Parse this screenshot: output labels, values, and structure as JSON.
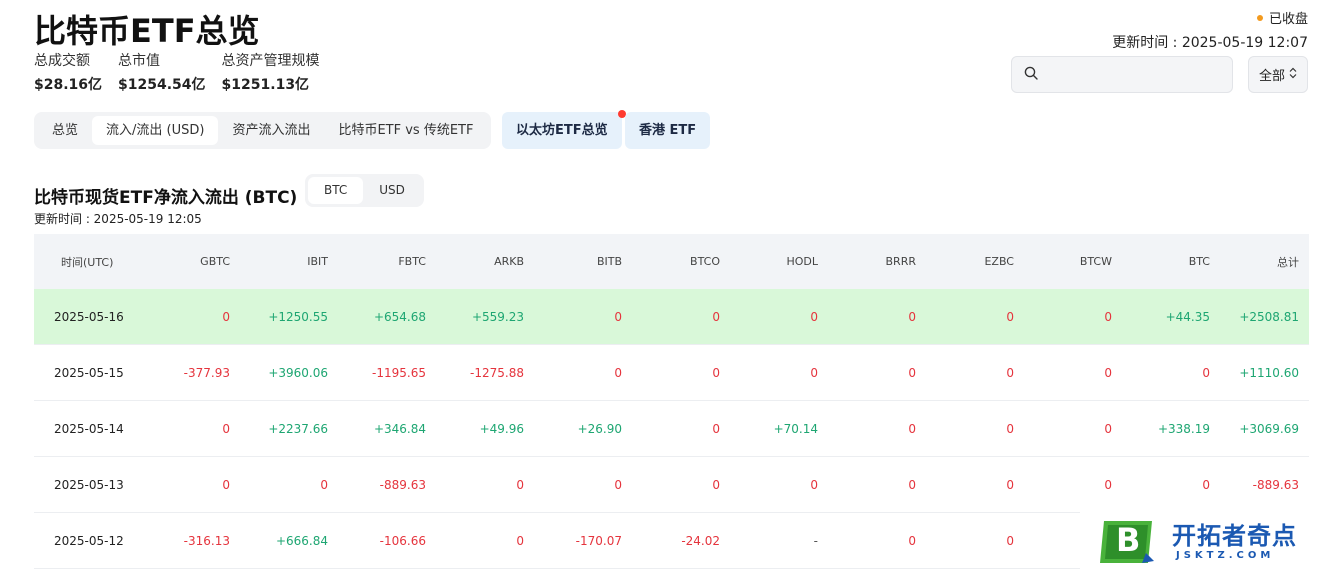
{
  "header": {
    "title": "比特币ETF总览",
    "status": "已收盘",
    "updated": "更新时间 : 2025-05-19 12:07",
    "stats": [
      {
        "label": "总成交额",
        "value": "$28.16亿"
      },
      {
        "label": "总市值",
        "value": "$1254.54亿"
      },
      {
        "label": "总资产管理规模",
        "value": "$1251.13亿"
      }
    ],
    "search_placeholder": "",
    "select_value": "全部"
  },
  "tabs": [
    {
      "label": "总览"
    },
    {
      "label": "流入/流出 (USD)"
    },
    {
      "label": "资产流入流出"
    },
    {
      "label": "比特币ETF vs 传统ETF"
    }
  ],
  "pills": [
    {
      "label": "以太坊ETF总览"
    },
    {
      "label": "香港 ETF"
    }
  ],
  "section": {
    "title": "比特币现货ETF净流入流出 (BTC)",
    "updated": "更新时间 : 2025-05-19 12:05",
    "toggle": [
      "BTC",
      "USD"
    ]
  },
  "table": {
    "columns": [
      "时间(UTC)",
      "GBTC",
      "IBIT",
      "FBTC",
      "ARKB",
      "BITB",
      "BTCO",
      "HODL",
      "BRRR",
      "EZBC",
      "BTCW",
      "BTC",
      "总计"
    ],
    "rows": [
      [
        "2025-05-16",
        "0",
        "+1250.55",
        "+654.68",
        "+559.23",
        "0",
        "0",
        "0",
        "0",
        "0",
        "0",
        "+44.35",
        "+2508.81"
      ],
      [
        "2025-05-15",
        "-377.93",
        "+3960.06",
        "-1195.65",
        "-1275.88",
        "0",
        "0",
        "0",
        "0",
        "0",
        "0",
        "0",
        "+1110.60"
      ],
      [
        "2025-05-14",
        "0",
        "+2237.66",
        "+346.84",
        "+49.96",
        "+26.90",
        "0",
        "+70.14",
        "0",
        "0",
        "0",
        "+338.19",
        "+3069.69"
      ],
      [
        "2025-05-13",
        "0",
        "0",
        "-889.63",
        "0",
        "0",
        "0",
        "0",
        "0",
        "0",
        "0",
        "0",
        "-889.63"
      ],
      [
        "2025-05-12",
        "-316.13",
        "+666.84",
        "-106.66",
        "0",
        "-170.07",
        "-24.02",
        "-",
        "0",
        "0",
        "",
        "",
        ""
      ]
    ]
  },
  "watermark": {
    "name": "开拓者奇点",
    "domain": "JSKTZ.COM",
    "letter": "B"
  },
  "colors": {
    "positive": "#1ea672",
    "negative": "#e5343d",
    "highlight_row": "#d9f8d9",
    "status_dot": "#f39a1e"
  }
}
